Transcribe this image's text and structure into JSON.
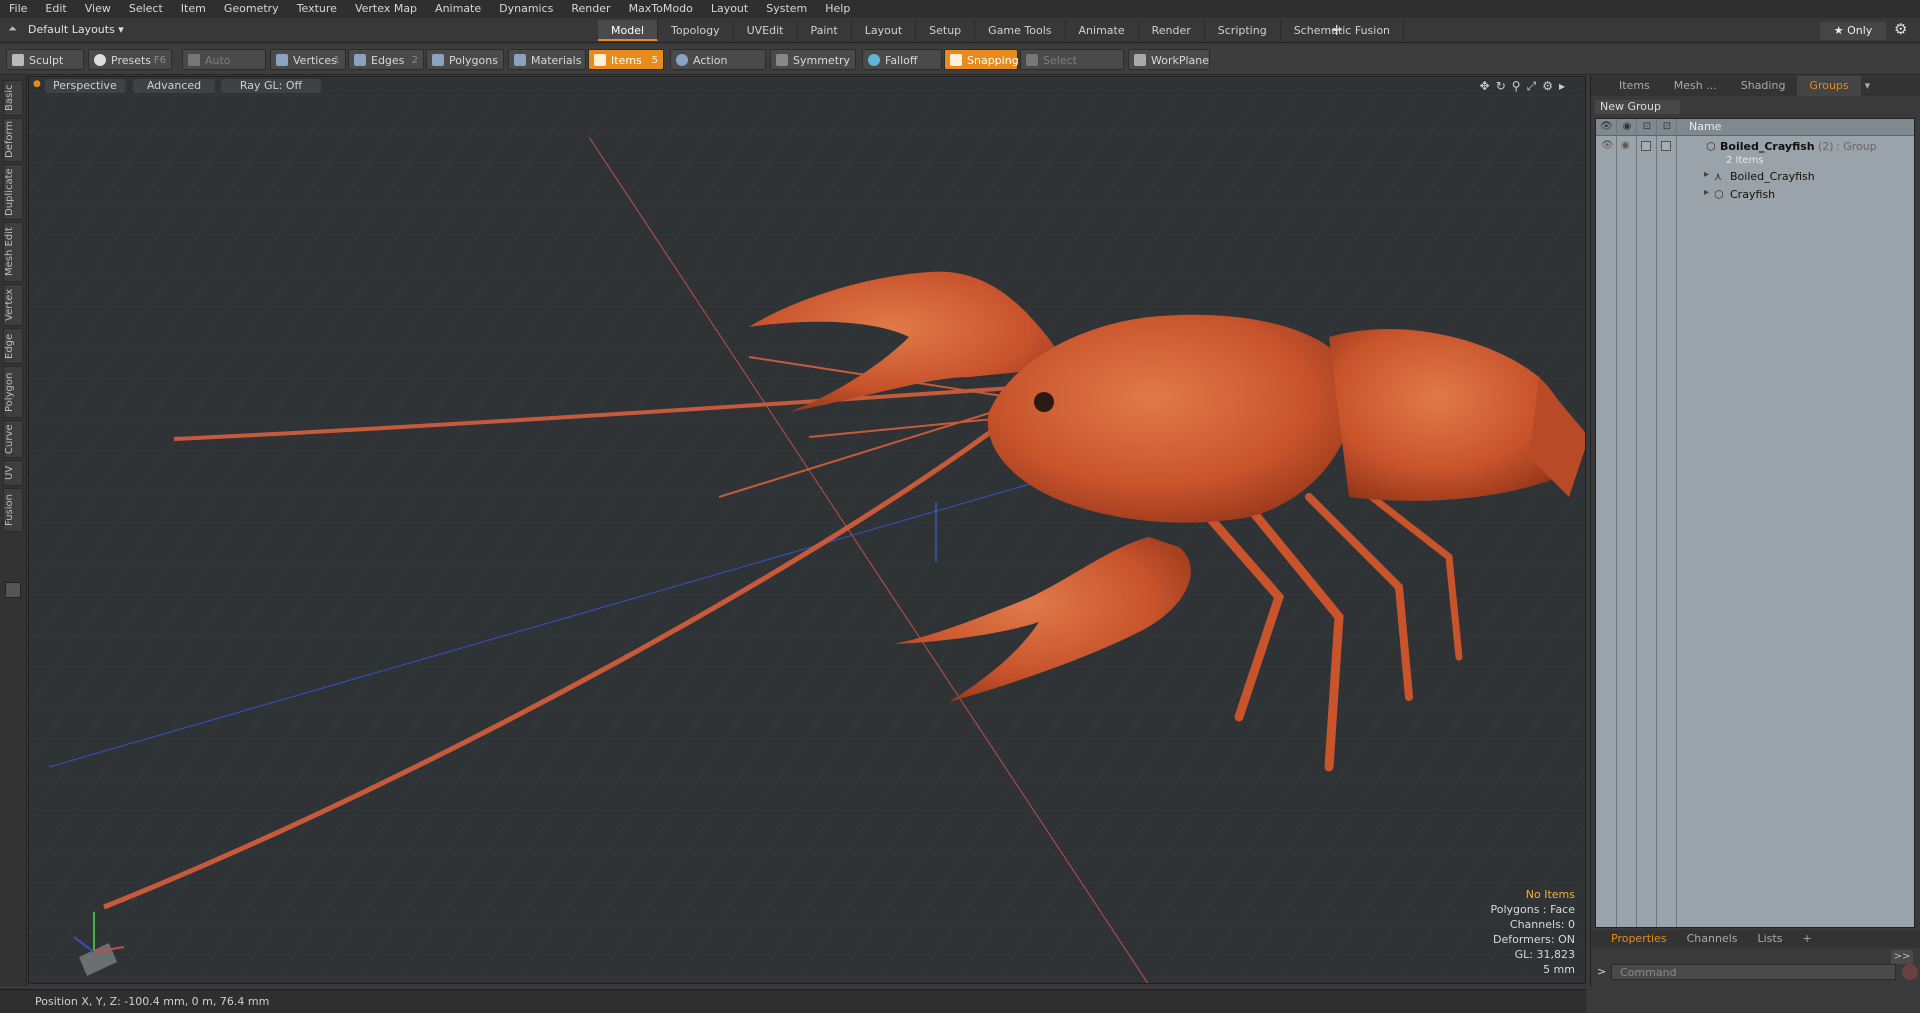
{
  "menu": [
    "File",
    "Edit",
    "View",
    "Select",
    "Item",
    "Geometry",
    "Texture",
    "Vertex Map",
    "Animate",
    "Dynamics",
    "Render",
    "MaxToModo",
    "Layout",
    "System",
    "Help"
  ],
  "layout": {
    "selector": "Default Layouts ▾",
    "tabs": [
      "Model",
      "Topology",
      "UVEdit",
      "Paint",
      "Layout",
      "Setup",
      "Game Tools",
      "Animate",
      "Render",
      "Scripting",
      "Schematic Fusion"
    ],
    "active_tab": "Model",
    "add_tab": "+",
    "only_label": "★ Only"
  },
  "toolbar": {
    "sculpt": "Sculpt",
    "presets": "Presets",
    "presets_key": "F6",
    "auto_select": "Auto Select",
    "vertices": "Vertices",
    "vertices_key": "1",
    "edges": "Edges",
    "edges_key": "2",
    "polygons": "Polygons",
    "materials": "Materials",
    "items": "Items",
    "items_key": "5",
    "action_center": "Action Center",
    "symmetry": "Symmetry",
    "falloff": "Falloff",
    "snapping": "Snapping",
    "select_through": "Select Through",
    "workplane": "WorkPlane"
  },
  "left_tabs": [
    "Basic",
    "Deform",
    "Duplicate",
    "Mesh Edit",
    "Vertex",
    "Edge",
    "Polygon",
    "Curve",
    "UV",
    "Fusion"
  ],
  "viewport": {
    "perspective": "Perspective",
    "advanced": "Advanced",
    "raygl": "Ray GL: Off",
    "info": {
      "no_items": "No Items",
      "polygons": "Polygons : Face",
      "channels": "Channels: 0",
      "deformers": "Deformers: ON",
      "gl": "GL: 31,823",
      "scale": "5 mm"
    }
  },
  "right_panel": {
    "tabs": [
      "Items",
      "Mesh ...",
      "Shading",
      "Groups"
    ],
    "active_tab": "Groups",
    "new_group": "New Group",
    "col_name": "Name",
    "group_name": "Boiled_Crayfish",
    "group_count": "(2)",
    "group_type": ": Group",
    "group_items": "2 Items",
    "child1": "Boiled_Crayfish",
    "child2": "Crayfish",
    "bottom_tabs": [
      "Properties",
      "Channels",
      "Lists",
      "+"
    ],
    "command_placeholder": "Command",
    "command_prompt": ">"
  },
  "status": {
    "position": "Position X, Y, Z:  -100.4 mm, 0 m, 76.4 mm"
  },
  "colors": {
    "accent": "#e88b1c",
    "crayfish": "#c9542c"
  }
}
